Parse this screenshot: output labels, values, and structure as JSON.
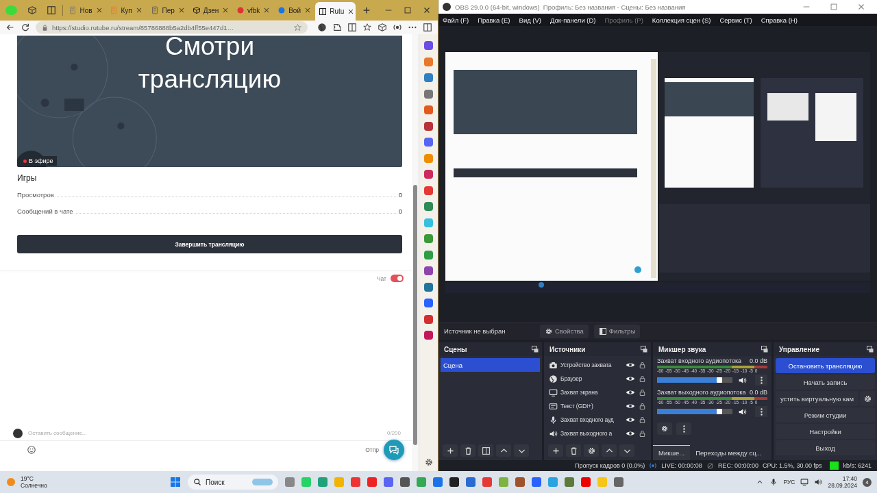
{
  "browser": {
    "tabs": [
      {
        "label": "Нов",
        "selected": false
      },
      {
        "label": "Куп",
        "selected": false
      },
      {
        "label": "Пер",
        "selected": false
      },
      {
        "label": "Дзен",
        "selected": false
      },
      {
        "label": "vfbk",
        "selected": false
      },
      {
        "label": "Вой",
        "selected": false
      },
      {
        "label": "Rutu",
        "selected": true
      }
    ],
    "address": "https://studio.rutube.ru/stream/85786888b5a2db4ff55e447d1…",
    "page": {
      "video_title": "Смотри трансляцию",
      "live_badge": "В эфире",
      "category": "Игры",
      "stats": [
        {
          "label": "Просмотров",
          "value": "0"
        },
        {
          "label": "Сообщений в чате",
          "value": "0"
        }
      ],
      "end_button": "Завершить трансляцию",
      "chat": {
        "label": "Чат",
        "on": true
      },
      "message_placeholder": "Оставить сообщение...",
      "counter": "0/200",
      "send_button": "Отпр"
    }
  },
  "obs": {
    "title": "OBS 29.0.0 (64-bit, windows)  Профиль: Без названия - Сцены: Без названия",
    "menu": [
      {
        "label": "Файл (F)",
        "disabled": false
      },
      {
        "label": "Правка (E)",
        "disabled": false
      },
      {
        "label": "Вид (V)",
        "disabled": false
      },
      {
        "label": "Док-панели (D)",
        "disabled": false
      },
      {
        "label": "Профиль (P)",
        "disabled": true
      },
      {
        "label": "Коллекция сцен (S)",
        "disabled": false
      },
      {
        "label": "Сервис (T)",
        "disabled": false
      },
      {
        "label": "Справка (H)",
        "disabled": false
      }
    ],
    "source_status": "Источник не выбран",
    "properties_button": "Свойства",
    "filters_button": "Фильтры",
    "scenes": {
      "title": "Сцены",
      "items": [
        {
          "name": "Сцена",
          "selected": true
        }
      ]
    },
    "sources": {
      "title": "Источники",
      "items": [
        {
          "name": "Устройство захвата",
          "kind": "camera"
        },
        {
          "name": "Браузер",
          "kind": "browser"
        },
        {
          "name": "Захват экрана",
          "kind": "screen"
        },
        {
          "name": "Текст (GDI+)",
          "kind": "text"
        },
        {
          "name": "Захват входного ауд",
          "kind": "mic"
        },
        {
          "name": "Захват выходного а",
          "kind": "speaker"
        }
      ]
    },
    "mixer": {
      "title": "Микшер звука",
      "channels": [
        {
          "name": "Захват входного аудиопотока",
          "reading": "0.0 dB",
          "scale": "-60 -55 -50 -45 -40 -35 -30 -25 -20 -15 -10 -5 0",
          "level": 0.86
        },
        {
          "name": "Захват выходного аудиопотока",
          "reading": "0.0 dB",
          "scale": "-60 -55 -50 -45 -40 -35 -30 -25 -20 -15 -10 -5 0",
          "level": 0.86
        }
      ],
      "tabs": [
        {
          "label": "Микше...",
          "selected": true
        },
        {
          "label": "Переходы между сц...",
          "selected": false
        }
      ]
    },
    "controls": {
      "title": "Управление",
      "buttons": [
        {
          "label": "Остановить трансляцию",
          "active": true,
          "kind": "plain"
        },
        {
          "label": "Начать запись",
          "active": false,
          "kind": "plain"
        },
        {
          "label": "устить виртуальную кам",
          "active": false,
          "kind": "gear"
        },
        {
          "label": "Режим студии",
          "active": false,
          "kind": "plain"
        },
        {
          "label": "Настройки",
          "active": false,
          "kind": "plain"
        },
        {
          "label": "Выход",
          "active": false,
          "kind": "plain"
        }
      ]
    },
    "status": {
      "dropped": "Пропуск кадров 0 (0.0%)",
      "live": "LIVE: 00:00:08",
      "rec": "REC: 00:00:00",
      "cpu": "CPU: 1.5%, 30.00 fps",
      "bitrate": "kb/s: 6241"
    }
  },
  "taskbar": {
    "temperature": "19°C",
    "weather": "Солнечно",
    "search": "Поиск",
    "language": "РУС",
    "time": "17:40",
    "date": "28.09.2024",
    "badge": "4"
  }
}
